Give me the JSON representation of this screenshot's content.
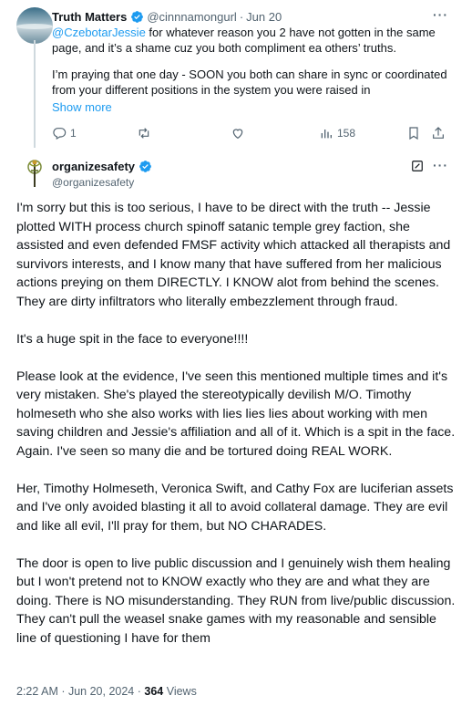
{
  "reply": {
    "name": "Truth Matters",
    "handle": "@cinnnamongurl",
    "separator": "·",
    "date": "Jun 20",
    "mention": "@CzebotarJessie",
    "line1": " for whatever reason you 2 have not gotten in the same page, and it’s a shame cuz you both compliment ea others’ truths.",
    "line2": "I’m praying that one day - SOON you both can share in sync or coordinated from your different positions in the system you were raised in",
    "show_more": "Show more",
    "more_dots": "···",
    "actions": {
      "reply_count": "1",
      "views_count": "158"
    }
  },
  "post": {
    "name": "organizesafety",
    "handle": "@organizesafety",
    "more_dots": "···",
    "paragraphs": [
      "I'm sorry but this is too serious, I have to be direct with the truth -- Jessie plotted WITH process church spinoff satanic temple grey faction, she assisted and even defended FMSF activity which attacked all therapists and survivors interests, and I know many that have suffered from her malicious actions preying on them DIRECTLY. I KNOW alot from behind the scenes. They are dirty infiltrators who literally embezzlement through fraud.",
      "It's a huge spit in the face to everyone!!!!",
      "Please look at the evidence, I've seen this mentioned multiple times and it's  very mistaken. She's played the stereotypically devilish M/O. Timothy holmeseth who she also works with lies lies lies about working with men saving children and Jessie's affiliation and all of it. Which is a spit in the face. Again. I've seen so many die and be tortured doing REAL WORK.",
      "Her, Timothy Holmeseth, Veronica Swift, and Cathy Fox are luciferian assets and I've only avoided blasting it all to avoid collateral damage. They are evil and like all evil, I'll pray for them, but NO CHARADES.",
      "The door is open to live public discussion and I genuinely wish them healing but I won't pretend not to KNOW exactly who they are and what they are doing. There is NO misunderstanding. They RUN from live/public discussion. They can't pull the weasel snake games with my reasonable and sensible line of questioning I have for them"
    ],
    "timestamp": "2:22 AM · Jun 20, 2024 · ",
    "views_count": "364",
    "views_label": " Views"
  },
  "icons": {
    "verified": "verified-badge-icon",
    "reply": "reply-icon",
    "repost": "repost-icon",
    "like": "like-icon",
    "views": "views-icon",
    "bookmark": "bookmark-icon",
    "share": "share-icon",
    "edit": "edit-icon"
  },
  "colors": {
    "accent": "#1d9bf0",
    "secondary_text": "#536471",
    "primary_text": "#0f1419",
    "thread_line": "#cfd9de"
  }
}
